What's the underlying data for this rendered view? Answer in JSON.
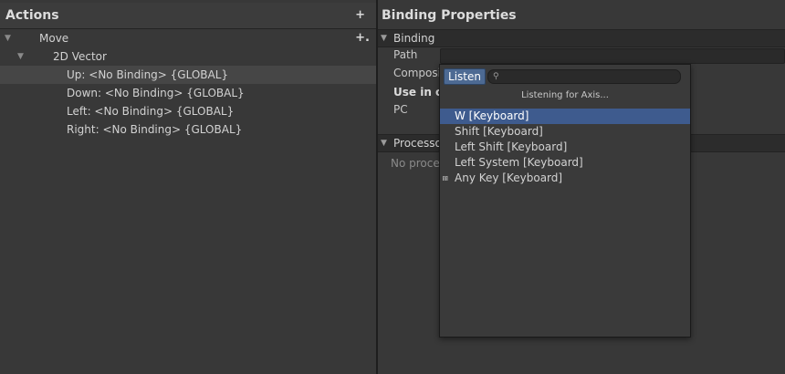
{
  "actions_panel": {
    "title": "Actions",
    "add_icon": "+",
    "tree": [
      {
        "label": "Move",
        "arrow": "▼",
        "add_binding_icon": "+."
      },
      {
        "label": "2D Vector",
        "arrow": "▼"
      },
      {
        "label": "Up: <No Binding> {GLOBAL}",
        "selected": true
      },
      {
        "label": "Down: <No Binding> {GLOBAL}"
      },
      {
        "label": "Left: <No Binding> {GLOBAL}"
      },
      {
        "label": "Right: <No Binding> {GLOBAL}"
      }
    ]
  },
  "binding_properties": {
    "title": "Binding Properties",
    "binding_section": {
      "arrow": "▼",
      "label": "Binding",
      "path_label": "Path",
      "composite_label": "Composi",
      "use_in_label": "Use in co",
      "pc_label": "PC"
    },
    "processors_section": {
      "arrow": "▼",
      "label": "Processo",
      "empty_text": "No proce"
    }
  },
  "listen_popup": {
    "listen_button": "Listen",
    "search_icon": "⚲",
    "search_placeholder": "",
    "status": "Listening for Axis...",
    "options": [
      {
        "label": "W [Keyboard]",
        "highlighted": true
      },
      {
        "label": "Shift [Keyboard]"
      },
      {
        "label": "Left Shift [Keyboard]"
      },
      {
        "label": "Left System [Keyboard]"
      },
      {
        "label": "Any Key [Keyboard]",
        "icon": "⩎"
      }
    ]
  },
  "colors": {
    "panel_bg": "#383838",
    "selected_row": "#464646",
    "highlight": "#3e5b8e",
    "listen_button": "#4d6a93"
  }
}
